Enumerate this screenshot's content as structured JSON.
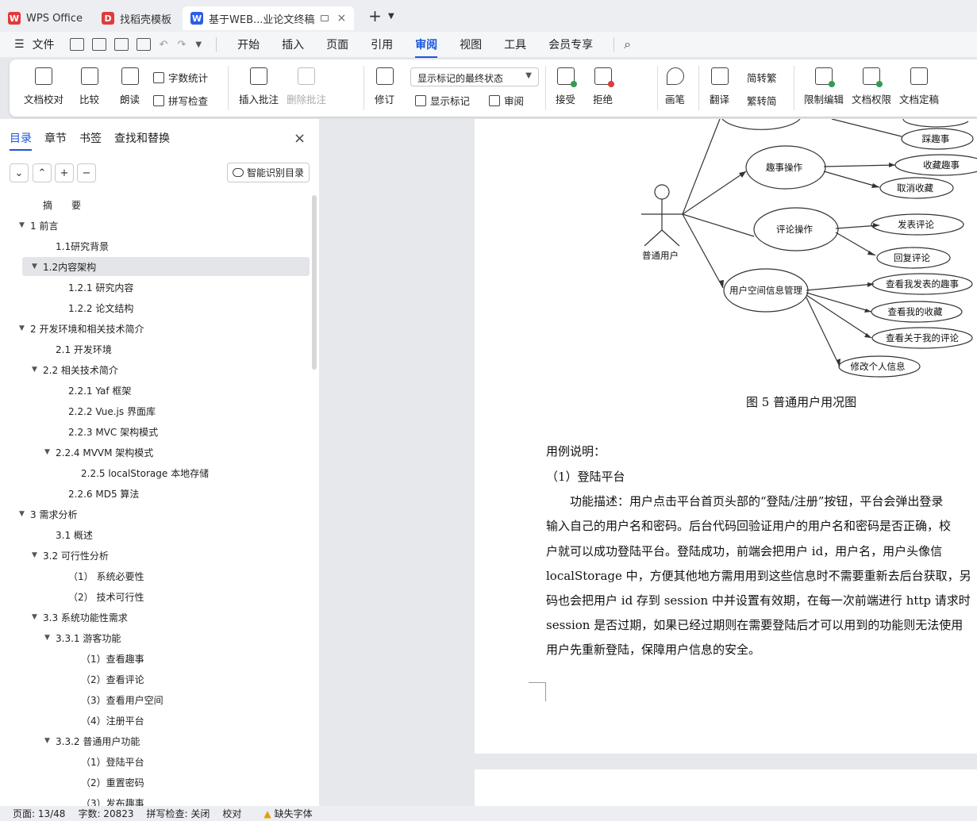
{
  "tabs": [
    {
      "label": "WPS Office",
      "icon": "wps-logo-icon",
      "color": "#e03b3b"
    },
    {
      "label": "找稻壳模板",
      "icon": "docer-logo-icon",
      "color": "#e03b3b"
    },
    {
      "label": "基于WEB...业论文终稿",
      "icon": "word-doc-icon",
      "color": "#2b5ee4"
    }
  ],
  "menu": {
    "file": "文件",
    "items": [
      "开始",
      "插入",
      "页面",
      "引用",
      "审阅",
      "视图",
      "工具",
      "会员专享"
    ],
    "active": "审阅",
    "accent": "#1a56db"
  },
  "ribbon": {
    "proofread": "文档校对",
    "compare": "比较",
    "read": "朗读",
    "word_count": "字数统计",
    "spell_check": "拼写检查",
    "insert_comment": "插入批注",
    "delete_comment": "删除批注",
    "revise": "修订",
    "markup_state": "显示标记的最终状态",
    "show_markup": "显示标记",
    "review": "审阅",
    "accept": "接受",
    "reject": "拒绝",
    "pen": "画笔",
    "translate": "翻译",
    "to_traditional": "简转繁",
    "to_simplified": "繁转简",
    "restrict_edit": "限制编辑",
    "doc_rights": "文档权限",
    "doc_finalize": "文档定稿"
  },
  "panel": {
    "tabs": [
      "目录",
      "章节",
      "书签",
      "查找和替换"
    ],
    "smart_toc": "智能识别目录"
  },
  "toc": [
    {
      "label": "摘　　要",
      "level": 1,
      "caret": ""
    },
    {
      "label": "1  前言",
      "level": 0,
      "caret": "▼"
    },
    {
      "label": "1.1研究背景",
      "level": 2,
      "caret": ""
    },
    {
      "label": "1.2内容架构",
      "level": 1,
      "caret": "▼",
      "selected": true
    },
    {
      "label": "1.2.1  研究内容",
      "level": 3,
      "caret": ""
    },
    {
      "label": "1.2.2  论文结构",
      "level": 3,
      "caret": ""
    },
    {
      "label": "2  开发环境和相关技术简介",
      "level": 0,
      "caret": "▼"
    },
    {
      "label": "2.1  开发环境",
      "level": 2,
      "caret": ""
    },
    {
      "label": "2.2  相关技术简介",
      "level": 1,
      "caret": "▼"
    },
    {
      "label": "2.2.1 Yaf 框架",
      "level": 3,
      "caret": ""
    },
    {
      "label": "2.2.2 Vue.js 界面库",
      "level": 3,
      "caret": ""
    },
    {
      "label": "2.2.3 MVC 架构模式",
      "level": 3,
      "caret": ""
    },
    {
      "label": "2.2.4 MVVM 架构模式",
      "level": 2,
      "caret": "▼"
    },
    {
      "label": "2.2.5 localStorage 本地存储",
      "level": 4,
      "caret": ""
    },
    {
      "label": "2.2.6 MD5 算法",
      "level": 3,
      "caret": ""
    },
    {
      "label": "3  需求分析",
      "level": 0,
      "caret": "▼"
    },
    {
      "label": "3.1  概述",
      "level": 2,
      "caret": ""
    },
    {
      "label": "3.2  可行性分析",
      "level": 1,
      "caret": "▼"
    },
    {
      "label": "（1）  系统必要性",
      "level": 3,
      "caret": ""
    },
    {
      "label": "（2）  技术可行性",
      "level": 3,
      "caret": ""
    },
    {
      "label": "3.3  系统功能性需求",
      "level": 1,
      "caret": "▼"
    },
    {
      "label": "3.3.1  游客功能",
      "level": 2,
      "caret": "▼"
    },
    {
      "label": "（1）查看趣事",
      "level": 4,
      "caret": ""
    },
    {
      "label": "（2）查看评论",
      "level": 4,
      "caret": ""
    },
    {
      "label": "（3）查看用户空间",
      "level": 4,
      "caret": ""
    },
    {
      "label": "（4）注册平台",
      "level": 4,
      "caret": ""
    },
    {
      "label": "3.3.2  普通用户功能",
      "level": 2,
      "caret": "▼"
    },
    {
      "label": "（1）登陆平台",
      "level": 4,
      "caret": ""
    },
    {
      "label": "（2）重置密码",
      "level": 4,
      "caret": ""
    },
    {
      "label": "（3）发布趣事",
      "level": 4,
      "caret": ""
    }
  ],
  "diagram": {
    "actor": "普通用户",
    "groups": [
      {
        "label": "趣事操作",
        "children": [
          "踩趣事",
          "收藏趣事",
          "取消收藏"
        ]
      },
      {
        "label": "评论操作",
        "children": [
          "发表评论",
          "回复评论"
        ]
      },
      {
        "label": "用户空间信息管理",
        "children": [
          "查看我发表的趣事",
          "查看我的收藏",
          "查看关于我的评论",
          "修改个人信息"
        ]
      }
    ]
  },
  "document": {
    "caption": "图 5   普通用户用况图",
    "lines": [
      "用例说明：",
      "（1）登陆平台",
      "　　功能描述：用户点击平台首页头部的“登陆/注册”按钮，平台会弹出登录",
      "输入自己的用户名和密码。后台代码回验证用户的用户名和密码是否正确，校",
      "户就可以成功登陆平台。登陆成功，前端会把用户 id，用户名，用户头像信",
      "localStorage 中，方便其他地方需用用到这些信息时不需要重新去后台获取，另",
      "码也会把用户 id 存到 session 中并设置有效期，在每一次前端进行 http 请求时",
      "session 是否过期，如果已经过期则在需要登陆后才可以用到的功能则无法使用",
      "用户先重新登陆，保障用户信息的安全。"
    ]
  },
  "status": {
    "page": "页面: 13/48",
    "words": "字数: 20823",
    "spell": "拼写检查: 关闭",
    "proof": "校对",
    "missing_font": "缺失字体"
  }
}
